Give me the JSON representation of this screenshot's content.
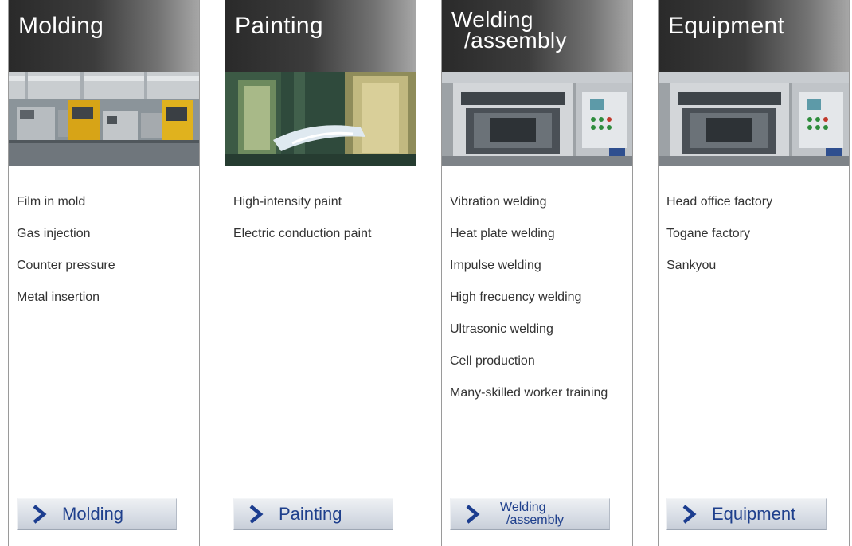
{
  "columns": [
    {
      "title": "Molding",
      "items": [
        "Film in mold",
        "Gas injection",
        "Counter pressure",
        "Metal insertion"
      ],
      "button_label": "Molding"
    },
    {
      "title": "Painting",
      "items": [
        "High-intensity paint",
        "Electric conduction paint"
      ],
      "button_label": "Painting"
    },
    {
      "title_line1": "Welding",
      "title_line2": "/assembly",
      "items": [
        "Vibration welding",
        "Heat plate welding",
        "Impulse welding",
        "High frecuency welding",
        "Ultrasonic welding",
        "Cell production",
        "Many-skilled worker training"
      ],
      "button_line1": "Welding",
      "button_line2": "/assembly"
    },
    {
      "title": "Equipment",
      "items": [
        "Head office factory",
        "Togane factory",
        "Sankyou"
      ],
      "button_label": "Equipment"
    }
  ],
  "colors": {
    "header_dark": "#2a2a2a",
    "header_light": "#a6a6a6",
    "item_text": "#333333",
    "button_text": "#1e3f8c",
    "chevron": "#1c3d8f"
  },
  "icons": {
    "button_chevron": "chevron-right-icon"
  }
}
